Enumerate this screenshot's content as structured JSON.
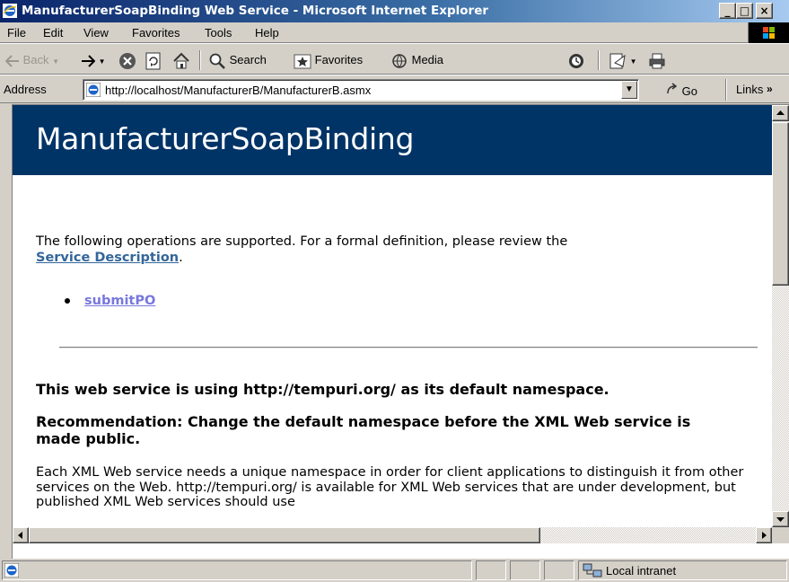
{
  "window": {
    "title": "ManufacturerSoapBinding Web Service - Microsoft Internet Explorer",
    "minimize_glyph": "_",
    "maximize_glyph": "□",
    "close_glyph": "×"
  },
  "menu": {
    "items": [
      "File",
      "Edit",
      "View",
      "Favorites",
      "Tools",
      "Help"
    ]
  },
  "toolbar": {
    "back_label": "Back",
    "search_label": "Search",
    "favorites_label": "Favorites",
    "media_label": "Media"
  },
  "address": {
    "label": "Address",
    "url": "http://localhost/ManufacturerB/ManufacturerB.asmx",
    "go_label": "Go",
    "links_label": "Links",
    "links_chevron": "»"
  },
  "page": {
    "heading": "ManufacturerSoapBinding",
    "intro_text": "The following operations are supported. For a formal definition, please review the",
    "service_description_link": "Service Description",
    "intro_period": ".",
    "operations": [
      "submitPO"
    ],
    "namespace_notice": "This web service is using http://tempuri.org/ as its default namespace.",
    "recommendation": "Recommendation: Change the default namespace before the XML Web service is made public.",
    "explanation": "Each XML Web service needs a unique namespace in order for client applications to distinguish it from other services on the Web. http://tempuri.org/ is available for XML Web services that are under development, but published XML Web services should use"
  },
  "status": {
    "zone": "Local intranet"
  },
  "colors": {
    "heading_bg": "#003366",
    "service_link": "#336699",
    "operation_link": "#7777dd",
    "titlebar_start": "#0a246a",
    "titlebar_end": "#a6caf0"
  }
}
